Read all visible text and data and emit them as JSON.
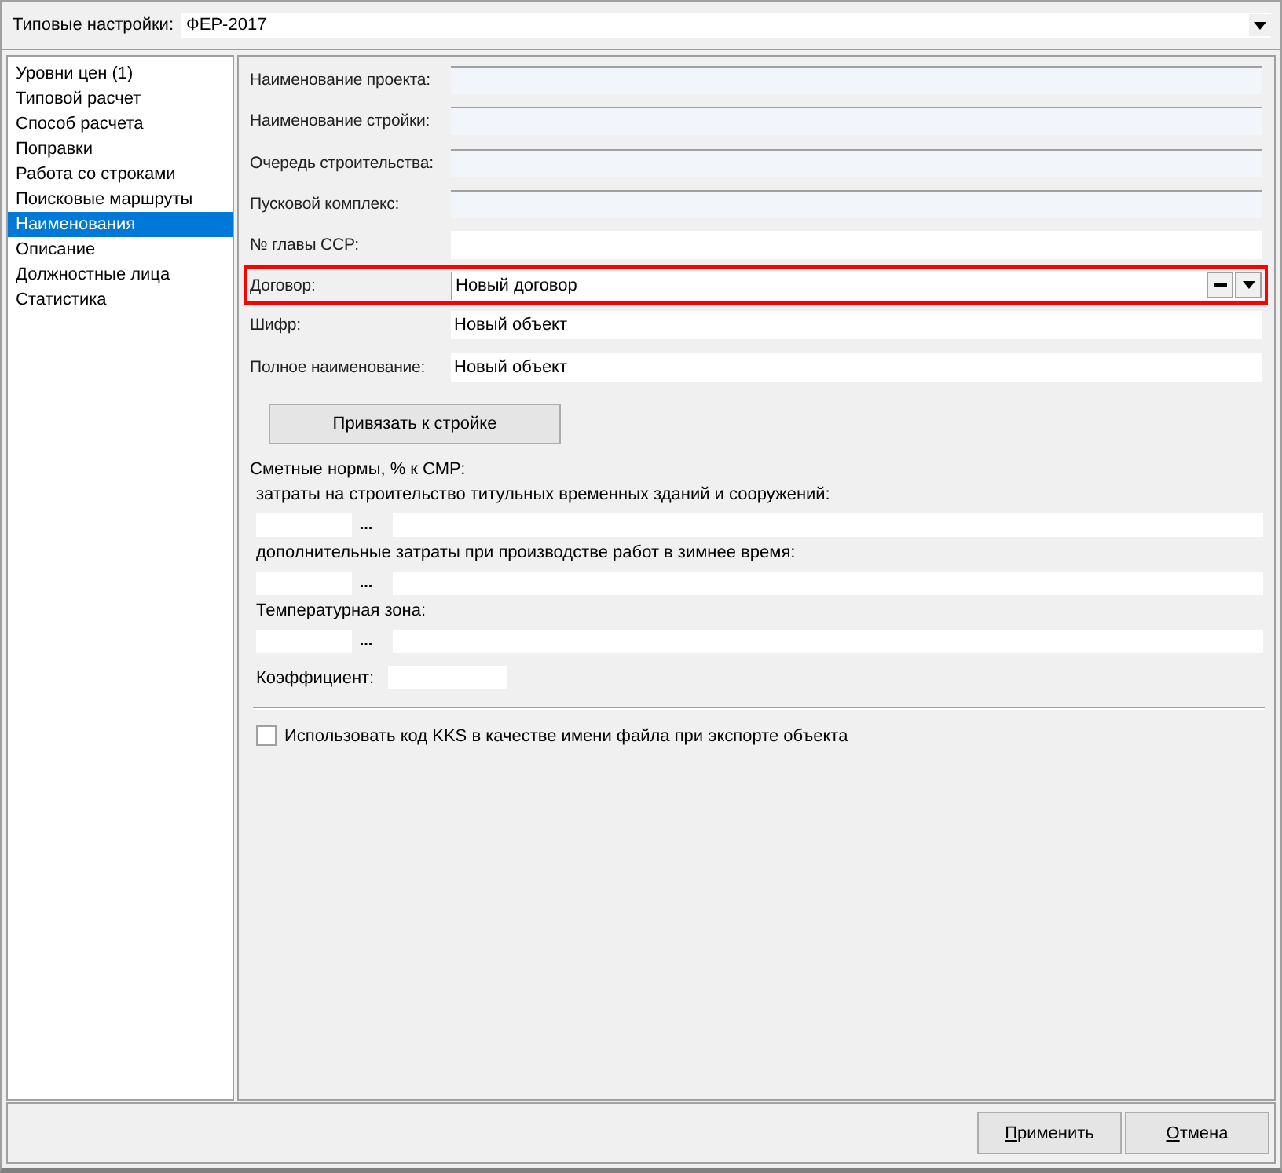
{
  "preset": {
    "label": "Типовые настройки:",
    "value": "ФЕР-2017"
  },
  "sidebar": {
    "items": [
      {
        "label": "Уровни цен (1)",
        "selected": false
      },
      {
        "label": "Типовой расчет",
        "selected": false
      },
      {
        "label": "Способ расчета",
        "selected": false
      },
      {
        "label": "Поправки",
        "selected": false
      },
      {
        "label": "Работа со строками",
        "selected": false
      },
      {
        "label": "Поисковые маршруты",
        "selected": false
      },
      {
        "label": "Наименования",
        "selected": true
      },
      {
        "label": "Описание",
        "selected": false
      },
      {
        "label": "Должностные лица",
        "selected": false
      },
      {
        "label": "Статистика",
        "selected": false
      }
    ]
  },
  "fields": [
    {
      "label": "Наименование проекта:",
      "kind": "readonly",
      "highlighted": false
    },
    {
      "label": "Наименование стройки:",
      "kind": "readonly",
      "highlighted": false
    },
    {
      "label": "Очередь строительства:",
      "kind": "readonly",
      "highlighted": false
    },
    {
      "label": "Пусковой комплекс:",
      "kind": "readonly",
      "highlighted": false
    },
    {
      "label": "№ главы ССР:",
      "kind": "text",
      "highlighted": false
    },
    {
      "label": "Договор:",
      "kind": "combo",
      "value": "Новый договор",
      "highlighted": true
    },
    {
      "label": "Шифр:",
      "kind": "text",
      "value": "Новый объект",
      "highlighted": false
    },
    {
      "label": "Полное наименование:",
      "kind": "text",
      "value": "Новый объект",
      "highlighted": false
    }
  ],
  "bind_button": "Привязать к стройке",
  "norms": {
    "title": "Сметные нормы, % к СМР:",
    "sections": [
      {
        "label": "затраты на строительство титульных временных зданий и сооружений:",
        "button": "..."
      },
      {
        "label": "дополнительные затраты при производстве работ в зимнее время:",
        "button": "..."
      },
      {
        "label": "Температурная зона:",
        "button": "..."
      }
    ],
    "coefficient_label": "Коэффициент:"
  },
  "kks_option": {
    "label": "Использовать код KKS в качестве имени файла при экспорте объекта",
    "checked": false
  },
  "buttons": [
    "Применить",
    "Отмена"
  ]
}
